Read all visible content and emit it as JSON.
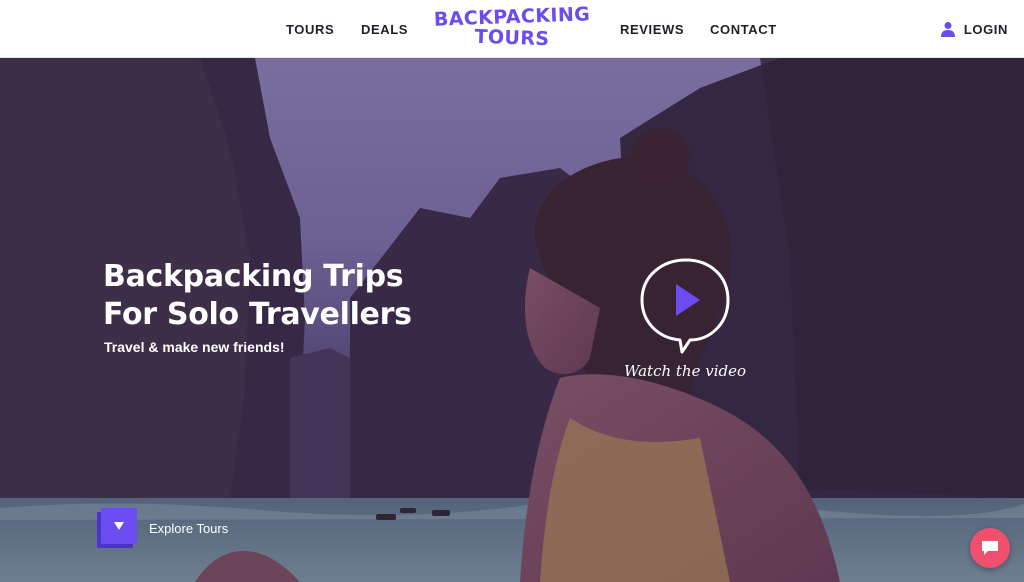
{
  "header": {
    "logo_line1": "BACKPACKING",
    "logo_line2": "TOURS",
    "nav": {
      "tours": "TOURS",
      "deals": "DEALS",
      "reviews": "REVIEWS",
      "contact": "CONTACT"
    },
    "login": "LOGIN",
    "login_icon": "user-icon"
  },
  "hero": {
    "title_line1": "Backpacking Trips",
    "title_line2": "For Solo Travellers",
    "subtitle": "Travel & make new friends!",
    "video_label": "Watch the video",
    "video_icon": "play-icon",
    "explore_label": "Explore Tours",
    "explore_icon": "chevron-down-icon"
  },
  "chat": {
    "icon": "chat-icon"
  },
  "colors": {
    "brand": "#6b4cf0",
    "chat": "#f0506e",
    "nav_text": "#1f1f2b"
  }
}
